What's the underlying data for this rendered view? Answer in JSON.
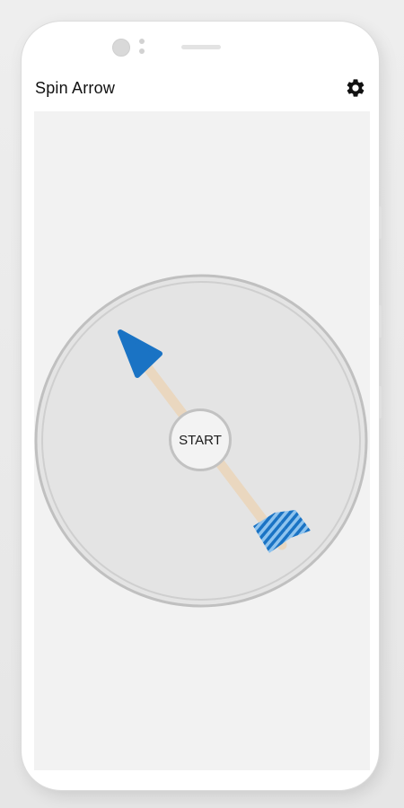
{
  "app": {
    "title": "Spin Arrow",
    "settings_icon": "gear-icon"
  },
  "spinner": {
    "start_label": "START"
  },
  "colors": {
    "arrow_head": "#1a73c4",
    "arrow_shaft": "#ead7bf",
    "fletching": "#1a73c4",
    "wheel_fill": "#e4e4e4",
    "wheel_ring": "#c4c4c4",
    "background": "#f2f2f2"
  }
}
